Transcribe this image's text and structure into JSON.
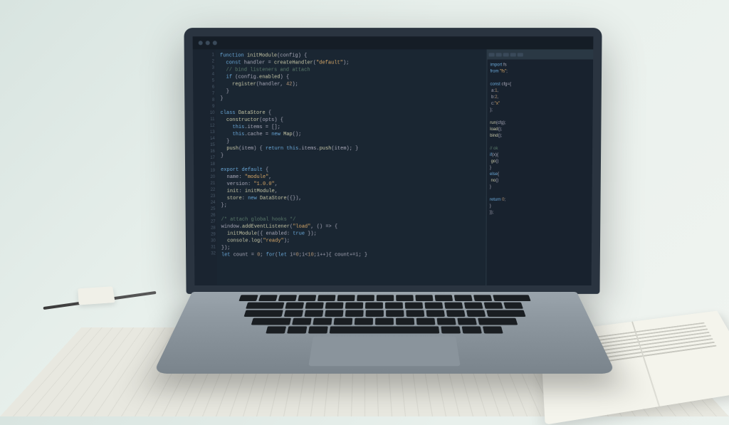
{
  "description": "Photograph of a laptop on a desk displaying a code editor with syntax-highlighted source code. Text on the screen is stylized/illegible in the source image.",
  "laptop": {
    "editor_theme": "dark",
    "panels": [
      "gutter",
      "main-code",
      "side-panel"
    ]
  },
  "desk_items": [
    "pencil",
    "eraser",
    "open-book"
  ]
}
